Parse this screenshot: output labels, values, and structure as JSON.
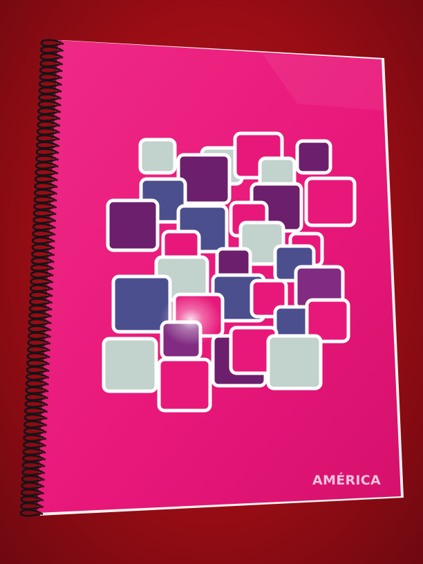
{
  "notebook": {
    "brand": "AMÉRICA",
    "colors": {
      "background": "#a40f18",
      "cover": "#e8187a",
      "cover_shade": "#d8126e",
      "page_edge": "#f4f1ee",
      "spiral": "#141418",
      "square_outline": "#ffffff",
      "gray": "#c2d2cd",
      "blue": "#4c4f8e",
      "purple": "#6c1f6c",
      "violet": "#812c82",
      "pink": "#e8187a"
    },
    "decoration": "squares-pattern"
  }
}
